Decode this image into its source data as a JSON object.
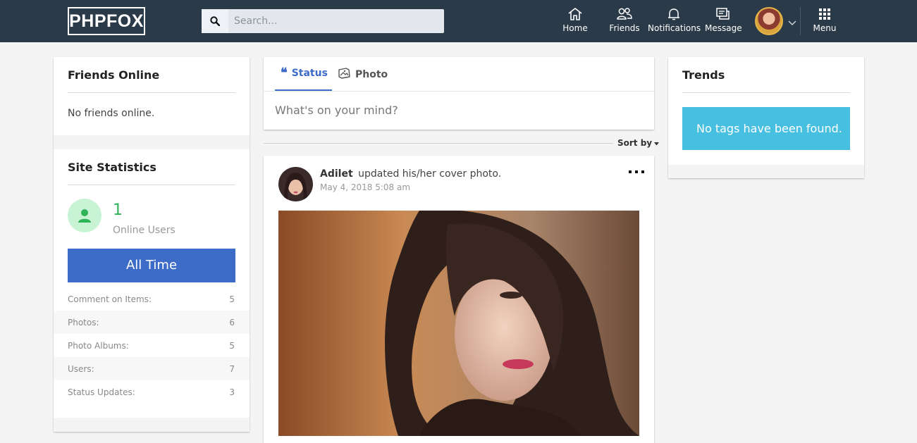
{
  "header": {
    "logo": "PHPFOX",
    "search_placeholder": "Search...",
    "nav": {
      "home": "Home",
      "friends": "Friends",
      "notifications": "Notifications",
      "message": "Message",
      "menu": "Menu"
    }
  },
  "friends_online": {
    "title": "Friends Online",
    "empty_text": "No friends online."
  },
  "site_statistics": {
    "title": "Site Statistics",
    "online_count": "1",
    "online_label": "Online Users",
    "all_time_label": "All Time",
    "rows": [
      {
        "label": "Comment on Items:",
        "value": "5"
      },
      {
        "label": "Photos:",
        "value": "6"
      },
      {
        "label": "Photo Albums:",
        "value": "5"
      },
      {
        "label": "Users:",
        "value": "7"
      },
      {
        "label": "Status Updates:",
        "value": "3"
      }
    ]
  },
  "composer": {
    "tab_status": "Status",
    "tab_photo": "Photo",
    "placeholder": "What's on your mind?"
  },
  "feed": {
    "sort_label": "Sort by",
    "post": {
      "author": "Adilet",
      "action": "updated his/her cover photo.",
      "timestamp": "May 4, 2018 5:08 am"
    }
  },
  "trends": {
    "title": "Trends",
    "empty_text": "No tags have been found."
  },
  "colors": {
    "topbar": "#2b3a48",
    "accent_blue": "#3c6bc8",
    "online_green": "#2fb45a",
    "trends_cyan": "#47bfe0"
  }
}
